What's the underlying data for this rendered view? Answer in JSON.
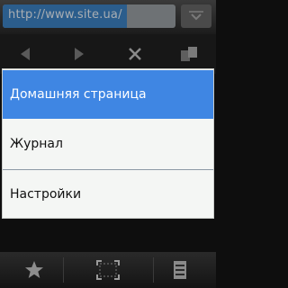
{
  "browser": {
    "url": "http://www.site.ua/"
  },
  "nav": {
    "icons": [
      "back-arrow-icon",
      "forward-arrow-icon",
      "stop-x-icon",
      "windows-icon"
    ]
  },
  "menu": {
    "items": [
      {
        "label": "Домашняя страница",
        "selected": true
      },
      {
        "label": "Журнал",
        "selected": false
      },
      {
        "label": "Настройки",
        "selected": false
      }
    ]
  },
  "toolbar": {
    "icons": [
      "bookmark-star-icon",
      "fullscreen-icon",
      "menu-options-icon"
    ]
  },
  "colors": {
    "accent": "#3f86e3",
    "menu_background": "#f4f6f4",
    "chrome_background": "#0e0e0e"
  }
}
